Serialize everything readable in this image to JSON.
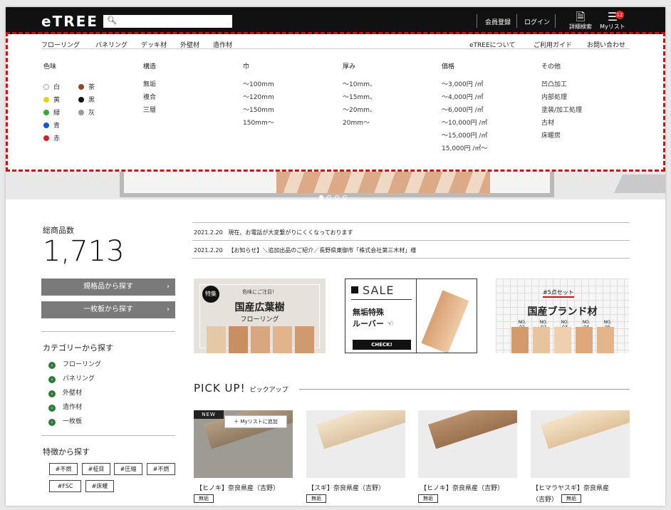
{
  "header": {
    "logo": "eTREE",
    "search_icon": "search-icon",
    "register": "会員登録",
    "login": "ログイン",
    "detail_search": "詳細検索",
    "mylist": "Myリスト",
    "mylist_count": "12"
  },
  "nav": {
    "left": [
      "フローリング",
      "パネリング",
      "デッキ材",
      "外壁材",
      "造作材"
    ],
    "right": [
      "eTREEについて",
      "ご利用ガイド",
      "お問い合わせ"
    ]
  },
  "mega": {
    "color": {
      "heading": "色味",
      "items": [
        {
          "label": "白",
          "color": "#ffffff"
        },
        {
          "label": "黄",
          "color": "#e8d500"
        },
        {
          "label": "緑",
          "color": "#3aa53a"
        },
        {
          "label": "青",
          "color": "#1a4fd6"
        },
        {
          "label": "赤",
          "color": "#d42020"
        },
        {
          "label": "茶",
          "color": "#8b4a2b"
        },
        {
          "label": "黒",
          "color": "#111111"
        },
        {
          "label": "灰",
          "color": "#9a9a9a"
        }
      ]
    },
    "structure": {
      "heading": "構造",
      "items": [
        "無垢",
        "複合",
        "三層"
      ]
    },
    "width": {
      "heading": "巾",
      "items": [
        "〜100mm",
        "〜120mm",
        "〜150mm",
        "150mm〜"
      ]
    },
    "thickness": {
      "heading": "厚み",
      "items": [
        "〜10mm、",
        "〜15mm、",
        "〜20mm、",
        "20mm〜"
      ]
    },
    "price": {
      "heading": "価格",
      "items": [
        "〜3,000円 /㎡",
        "〜4,000円 /㎡",
        "〜6,000円 /㎡",
        "〜10,000円 /㎡",
        "〜15,000円 /㎡",
        "15,000円 /㎡〜"
      ]
    },
    "other": {
      "heading": "その他",
      "items": [
        "凹凸加工",
        "内部処理",
        "塗装/加工処理",
        "古材",
        "床暖房"
      ]
    }
  },
  "left": {
    "total_label": "総商品数",
    "total_value": "1,713",
    "btn_standard": "規格品から探す",
    "btn_single": "一枚板から探す",
    "category_heading": "カテゴリーから探す",
    "categories": [
      "フローリング",
      "パネリング",
      "外壁材",
      "造作材",
      "一枚板"
    ],
    "feature_heading": "特徴から探す",
    "tags": [
      "#不燃",
      "#柾目",
      "#圧縮",
      "#不燃",
      "#FSC",
      "#床暖"
    ]
  },
  "news": [
    {
      "date": "2021.2.20",
      "text": "現在、お電話が大変繋がりにくくなっております"
    },
    {
      "date": "2021.2.20",
      "text": "【お知らせ】＼追加出品のご紹介／長野県東御市「株式会社第三木材」様"
    }
  ],
  "banners": {
    "b1": {
      "badge": "特集",
      "small": "色味にご注目！",
      "big": "国産広葉樹",
      "sub": "フローリング"
    },
    "b2": {
      "sale": "SALE",
      "line1": "無垢特殊",
      "line2": "ルーバー",
      "btn": "CHECK!"
    },
    "b3": {
      "pill": "#5点セット",
      "big": "国産ブランド材",
      "nos": [
        "01",
        "02",
        "03",
        "04",
        "05"
      ],
      "no_label": "NO."
    }
  },
  "pickup": {
    "title": "PICK UP!",
    "subtitle": "ピックアップ",
    "new_label": "NEW",
    "add_label": "＋ Myリストに追加",
    "cards": [
      {
        "title": "【ヒノキ】奈良県産（吉野）",
        "tag": "無垢"
      },
      {
        "title": "【スギ】奈良県産（吉野）",
        "tag": "無垢"
      },
      {
        "title": "【ヒノキ】奈良県産（吉野）",
        "tag": "無垢"
      },
      {
        "title": "【ヒマラヤスギ】奈良県産",
        "title2": "（吉野）",
        "tag": "無垢"
      }
    ]
  }
}
